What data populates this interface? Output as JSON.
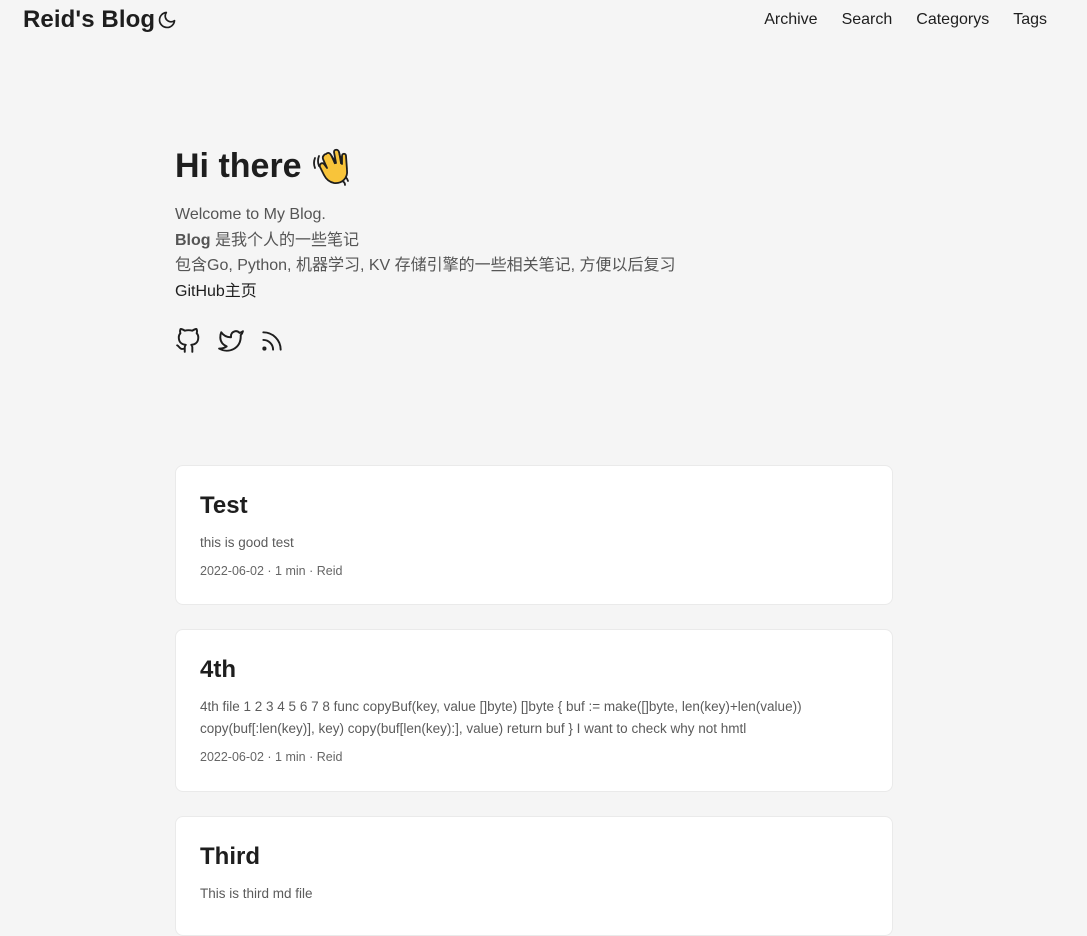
{
  "header": {
    "logo": "Reid's Blog",
    "nav": [
      "Archive",
      "Search",
      "Categorys",
      "Tags"
    ]
  },
  "home": {
    "title": "Hi there",
    "lines": {
      "welcome": "Welcome to My Blog.",
      "blog_bold": "Blog",
      "blog_rest": " 是我个人的一些笔记",
      "topics": "包含Go, Python, 机器学习, KV 存储引擎的一些相关笔记, 方便以后复习",
      "github_link": "GitHub主页"
    },
    "social_icons": [
      "github-icon",
      "twitter-icon",
      "rss-icon"
    ]
  },
  "posts": [
    {
      "title": "Test",
      "summary": "this is good test",
      "meta": "2022-06-02 · 1 min · Reid"
    },
    {
      "title": "4th",
      "summary": "4th file 1 2 3 4 5 6 7 8 func copyBuf(key, value []byte) []byte { buf := make([]byte, len(key)+len(value)) copy(buf[:len(key)], key) copy(buf[len(key):], value) return buf } I want to check why not hmtl",
      "meta": "2022-06-02 · 1 min · Reid"
    },
    {
      "title": "Third",
      "summary": "This is third md file",
      "meta": ""
    }
  ],
  "colors": {
    "background": "#f5f5f5",
    "card": "#ffffff",
    "primary_text": "#1e1e1e",
    "secondary_text": "#555555",
    "wave_emoji": "#f8c43a"
  }
}
